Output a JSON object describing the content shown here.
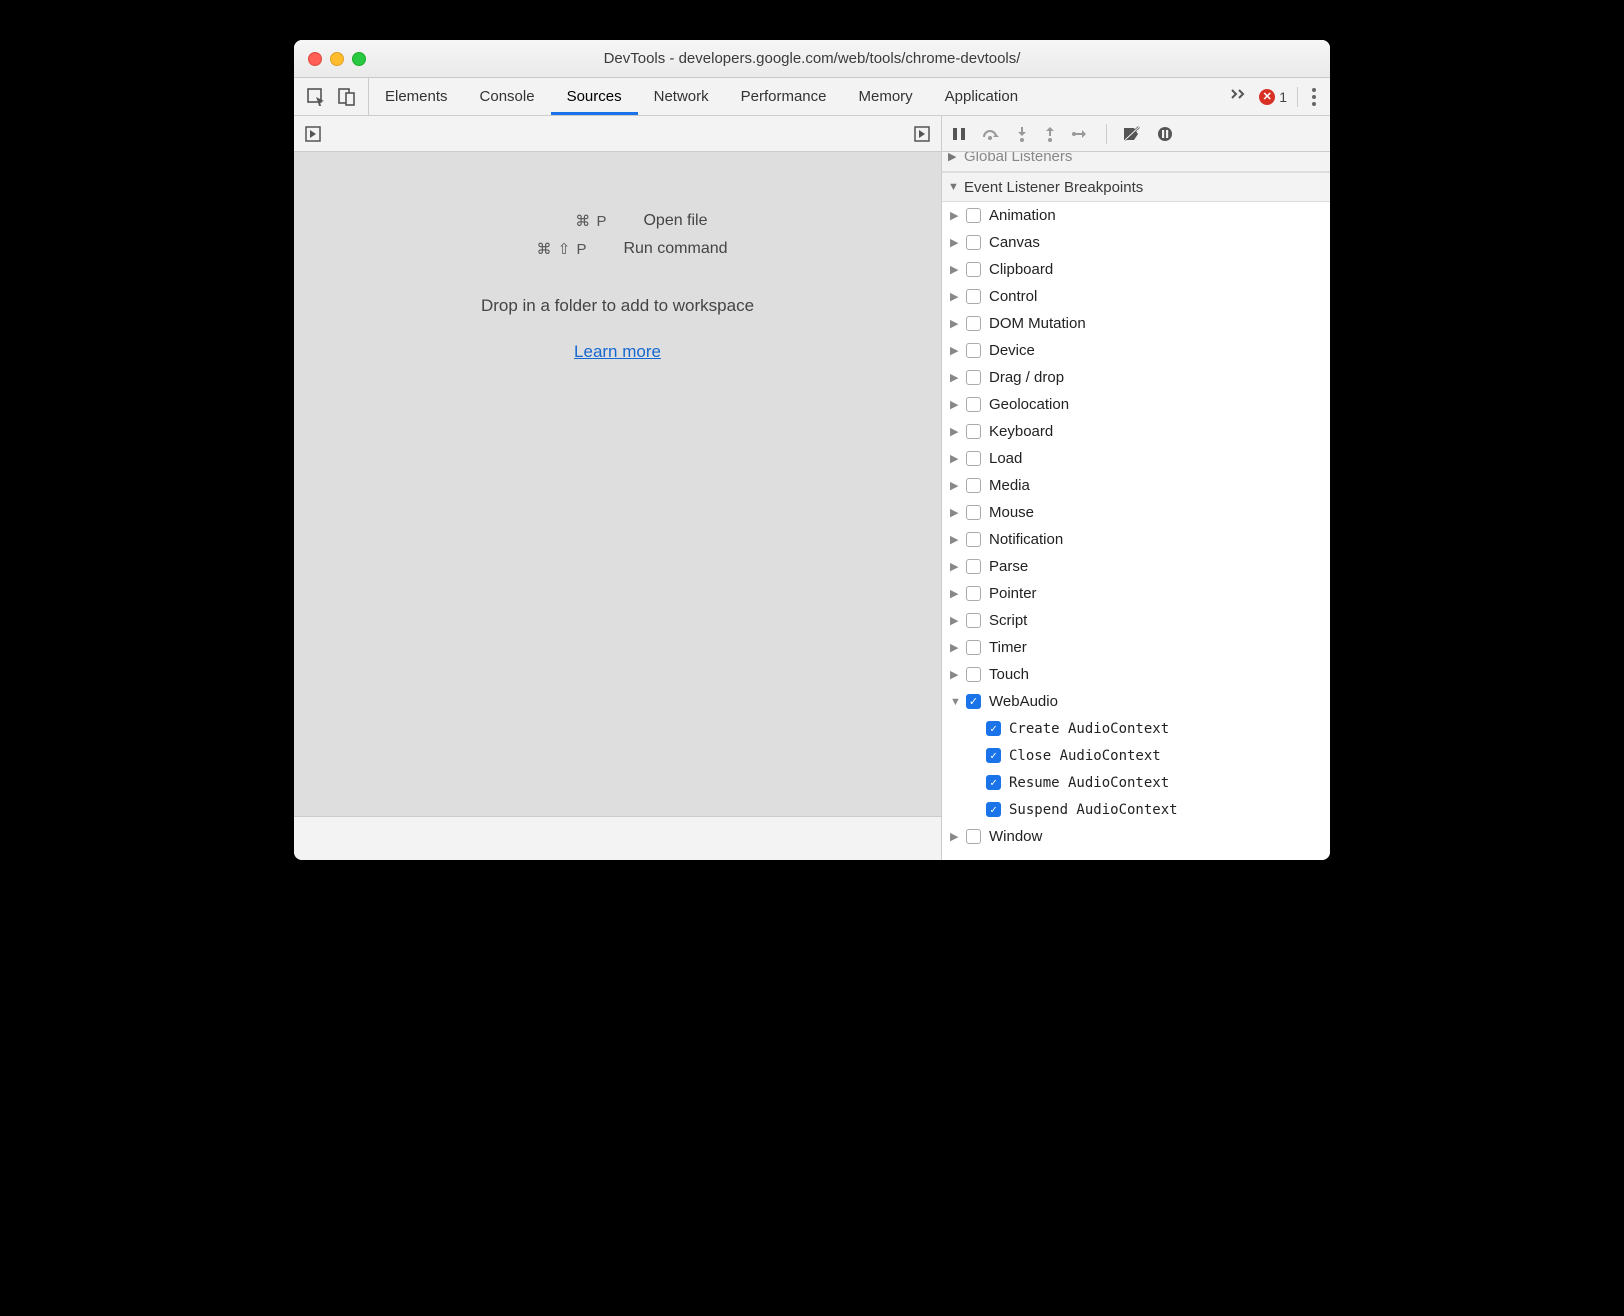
{
  "window": {
    "title": "DevTools - developers.google.com/web/tools/chrome-devtools/"
  },
  "tabs": {
    "items": [
      "Elements",
      "Console",
      "Sources",
      "Network",
      "Performance",
      "Memory",
      "Application"
    ],
    "active": "Sources"
  },
  "errors": {
    "count": "1"
  },
  "hints": {
    "open_file_keys": "⌘ P",
    "open_file_label": "Open file",
    "run_cmd_keys": "⌘ ⇧ P",
    "run_cmd_label": "Run command",
    "drop_text": "Drop in a folder to add to workspace",
    "learn_more": "Learn more"
  },
  "sections": {
    "global_listeners": "Global Listeners",
    "event_breakpoints": "Event Listener Breakpoints"
  },
  "categories": [
    {
      "label": "Animation",
      "checked": false,
      "expanded": false
    },
    {
      "label": "Canvas",
      "checked": false,
      "expanded": false
    },
    {
      "label": "Clipboard",
      "checked": false,
      "expanded": false
    },
    {
      "label": "Control",
      "checked": false,
      "expanded": false
    },
    {
      "label": "DOM Mutation",
      "checked": false,
      "expanded": false
    },
    {
      "label": "Device",
      "checked": false,
      "expanded": false
    },
    {
      "label": "Drag / drop",
      "checked": false,
      "expanded": false
    },
    {
      "label": "Geolocation",
      "checked": false,
      "expanded": false
    },
    {
      "label": "Keyboard",
      "checked": false,
      "expanded": false
    },
    {
      "label": "Load",
      "checked": false,
      "expanded": false
    },
    {
      "label": "Media",
      "checked": false,
      "expanded": false
    },
    {
      "label": "Mouse",
      "checked": false,
      "expanded": false
    },
    {
      "label": "Notification",
      "checked": false,
      "expanded": false
    },
    {
      "label": "Parse",
      "checked": false,
      "expanded": false
    },
    {
      "label": "Pointer",
      "checked": false,
      "expanded": false
    },
    {
      "label": "Script",
      "checked": false,
      "expanded": false
    },
    {
      "label": "Timer",
      "checked": false,
      "expanded": false
    },
    {
      "label": "Touch",
      "checked": false,
      "expanded": false
    },
    {
      "label": "WebAudio",
      "checked": true,
      "expanded": true,
      "children": [
        {
          "label": "Create AudioContext",
          "checked": true
        },
        {
          "label": "Close AudioContext",
          "checked": true
        },
        {
          "label": "Resume AudioContext",
          "checked": true
        },
        {
          "label": "Suspend AudioContext",
          "checked": true
        }
      ]
    },
    {
      "label": "Window",
      "checked": false,
      "expanded": false
    }
  ]
}
